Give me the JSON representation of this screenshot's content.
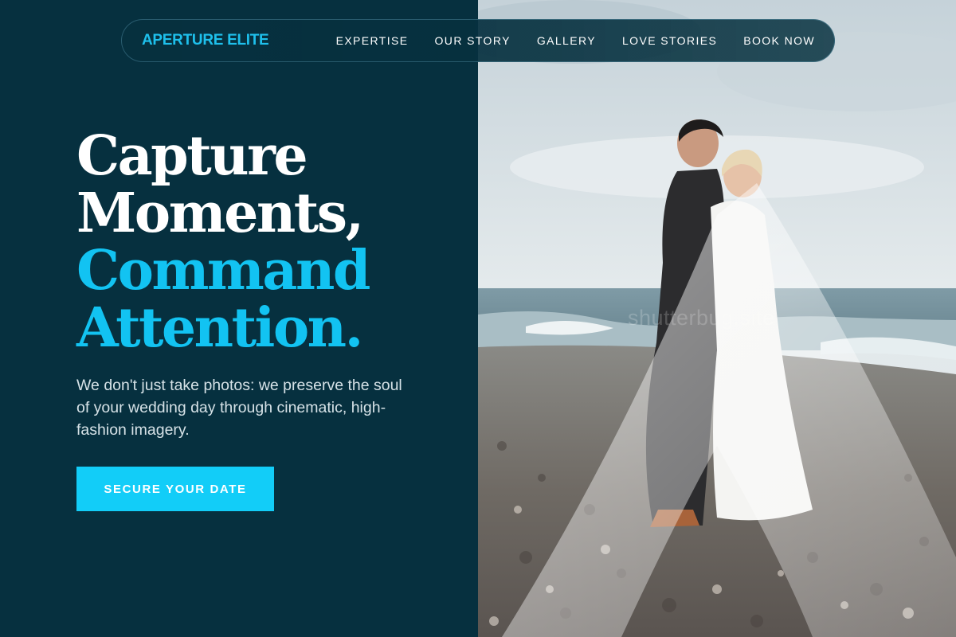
{
  "brand": {
    "logo_text": "APERTURE ELITE"
  },
  "nav": {
    "items": [
      {
        "label": "EXPERTISE"
      },
      {
        "label": "OUR STORY"
      },
      {
        "label": "GALLERY"
      },
      {
        "label": "LOVE STORIES"
      },
      {
        "label": "BOOK NOW"
      }
    ]
  },
  "hero": {
    "headline_line1": "Capture",
    "headline_line2": "Moments,",
    "headline_line3": "Command",
    "headline_line4": "Attention.",
    "subtext": "We don't just take photos: we preserve the soul of your wedding day through cinematic, high-fashion imagery.",
    "cta_label": "SECURE YOUR DATE"
  },
  "photo": {
    "watermark": "shutterbug.site"
  },
  "colors": {
    "background": "#06303f",
    "accent": "#12c3f2",
    "button": "#12cdf8",
    "text_light": "#d6e2e7"
  }
}
